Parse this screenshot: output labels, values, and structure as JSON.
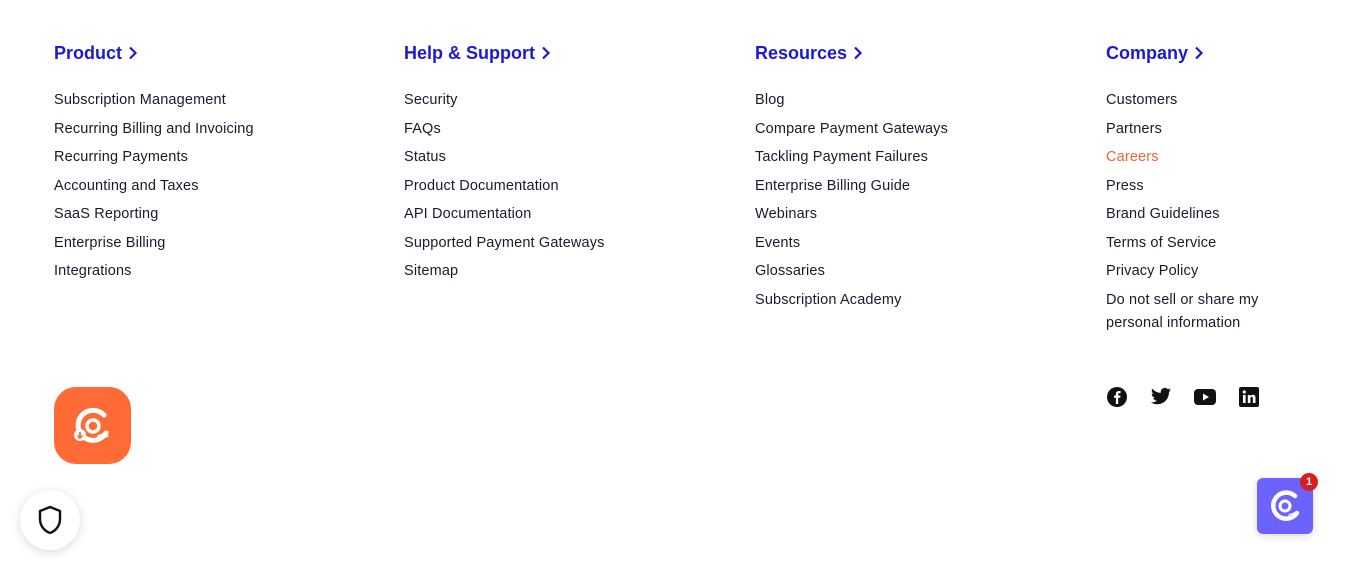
{
  "columns": [
    {
      "title": "Product",
      "links": [
        "Subscription Management",
        "Recurring Billing and Invoicing",
        "Recurring Payments",
        "Accounting and Taxes",
        "SaaS Reporting",
        "Enterprise Billing",
        "Integrations"
      ]
    },
    {
      "title": "Help & Support",
      "links": [
        "Security",
        "FAQs",
        "Status",
        "Product Documentation",
        "API Documentation",
        "Supported Payment Gateways",
        "Sitemap"
      ]
    },
    {
      "title": "Resources",
      "links": [
        "Blog",
        "Compare Payment Gateways",
        "Tackling Payment Failures",
        "Enterprise Billing Guide",
        "Webinars",
        "Events",
        "Glossaries",
        "Subscription Academy"
      ]
    },
    {
      "title": "Company",
      "links": [
        "Customers",
        "Partners",
        "Careers",
        "Press",
        "Brand Guidelines",
        "Terms of Service",
        "Privacy Policy",
        "Do not sell or share my personal information"
      ]
    }
  ],
  "highlighted_link": "Careers",
  "colors": {
    "heading": "#1a19d6",
    "link": "#1a1a2e",
    "highlight": "#f26430",
    "brand_logo_bg": "#ff6b35",
    "chat_bg": "#6c63ff",
    "badge_bg": "#d81e1e"
  },
  "social_icons": [
    "facebook-icon",
    "twitter-icon",
    "youtube-icon",
    "linkedin-icon"
  ],
  "chat_badge_count": "1"
}
